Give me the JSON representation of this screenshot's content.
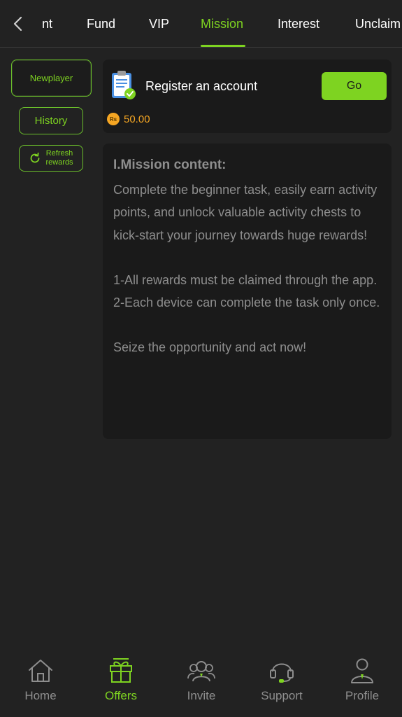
{
  "header": {
    "tabs": [
      {
        "label": "nt"
      },
      {
        "label": "Fund"
      },
      {
        "label": "VIP"
      },
      {
        "label": "Mission",
        "active": true
      },
      {
        "label": "Interest"
      },
      {
        "label": "Unclaim"
      }
    ]
  },
  "sidebar": {
    "newplayer": "Newplayer",
    "history": "History",
    "refresh_line1": "Refresh",
    "refresh_line2": "rewards"
  },
  "task": {
    "title": "Register an account",
    "go_label": "Go",
    "currency_symbol": "Rs",
    "reward": "50.00"
  },
  "content": {
    "heading": "I.Mission content:",
    "intro": "Complete the beginner task, easily earn activity points, and unlock valuable activity chests to kick-start your journey towards huge rewards!",
    "rule1": "1-All rewards must be claimed through the app.",
    "rule2": "2-Each device can complete the task only once.",
    "closing": "Seize the opportunity and act now!"
  },
  "nav": {
    "items": [
      {
        "label": "Home",
        "icon": "home-icon"
      },
      {
        "label": "Offers",
        "icon": "gift-icon",
        "active": true
      },
      {
        "label": "Invite",
        "icon": "invite-icon"
      },
      {
        "label": "Support",
        "icon": "headset-icon"
      },
      {
        "label": "Profile",
        "icon": "profile-icon"
      }
    ]
  },
  "colors": {
    "accent": "#7ed321",
    "background": "#222222",
    "card": "#1a1a1a",
    "reward": "#f5a623",
    "muted_text": "#8e8e8e"
  }
}
